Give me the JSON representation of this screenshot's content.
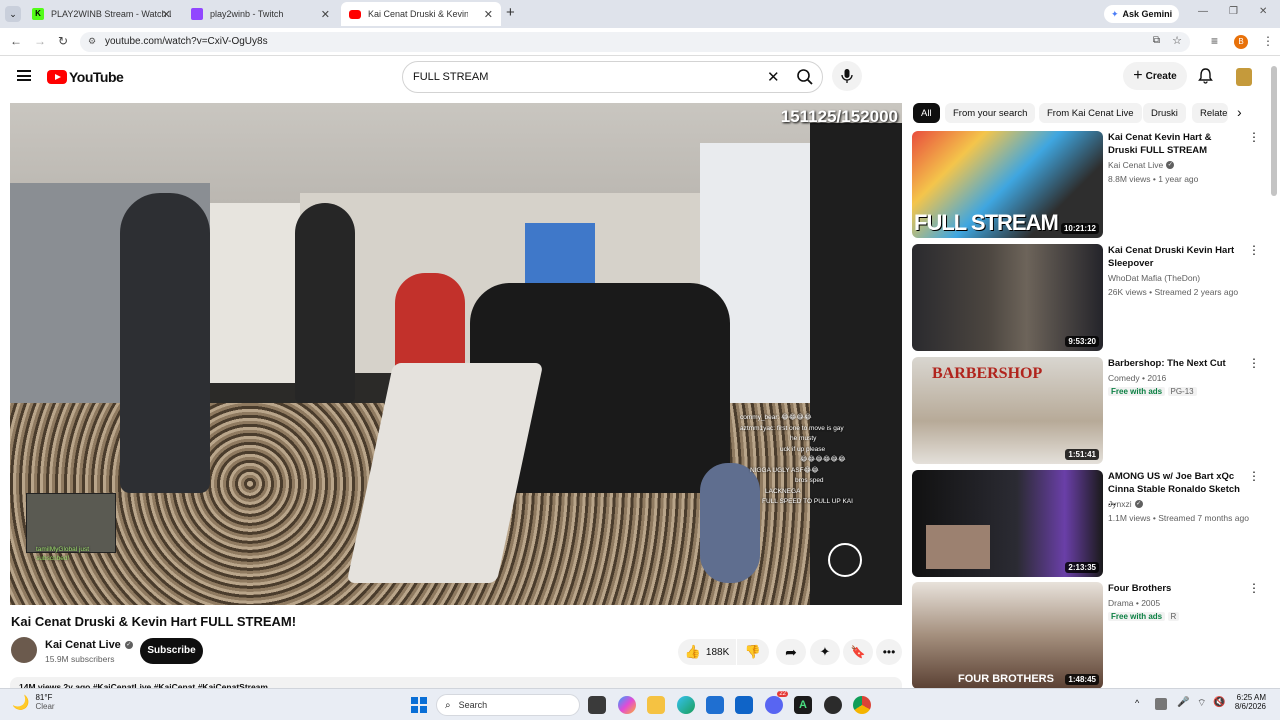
{
  "browser": {
    "tabs": [
      {
        "label": "PLAY2WINB Stream - Watch Liv",
        "active": false,
        "icon": "kick-icon"
      },
      {
        "label": "play2winb - Twitch",
        "active": false,
        "icon": "twitch-icon"
      },
      {
        "label": "Kai Cenat Druski & Kevin H",
        "active": true,
        "icon": "youtube-icon"
      }
    ],
    "new_tab": "+",
    "ask_gemini": "Ask Gemini",
    "url": "youtube.com/watch?v=CxiV-OgUy8s",
    "profile_initial": "B"
  },
  "youtube": {
    "logo_text": "YouTube",
    "search_value": "FULL STREAM",
    "create_label": "Create"
  },
  "video": {
    "overlay_counter": "151125/152000",
    "title": "Kai Cenat Druski & Kevin Hart FULL STREAM!",
    "channel": "Kai Cenat Live",
    "subscribers": "15.9M subscribers",
    "subscribe_label": "Subscribe",
    "likes": "188K",
    "description_line": "14M views  2y ago  #KaiCenatLive #KaiCenat #KaiCenatStream",
    "chat_lines": [
      "commy_bear: 😂😂😂😂",
      "aztmm1yac: first one to move is gay",
      "he musty",
      "uck if up please",
      "😂😂😂😂😂😂",
      "NIGGA UGLY ASF😂😂",
      "bros sped",
      "LACKNEGA",
      "FULL SPEED TO PULL UP KAI"
    ],
    "sub_alert": "tamilMyGlobal just subscribed!"
  },
  "sidebar": {
    "chips": [
      "All",
      "From your search",
      "From Kai Cenat Live",
      "Druski",
      "Relate"
    ],
    "recommendations": [
      {
        "title": "Kai Cenat Kevin Hart & Druski FULL STREAM",
        "channel": "Kai Cenat Live",
        "verified": true,
        "meta": "8.8M views • 1 year ago",
        "duration": "10:21:12",
        "thumb_text": "FULL STREAM"
      },
      {
        "title": "Kai Cenat Druski Kevin Hart Sleepover",
        "channel": "WhoDat Mafia (TheDon)",
        "verified": false,
        "meta": "26K views • Streamed 2 years ago",
        "duration": "9:53:20",
        "thumb_text": ""
      },
      {
        "title": "Barbershop: The Next Cut",
        "channel": "Comedy • 2016",
        "verified": false,
        "meta_tag": "Free with ads",
        "rating": "PG-13",
        "duration": "1:51:41",
        "thumb_text": "BARBERSHOP"
      },
      {
        "title": "AMONG US w/ Joe Bart xQc Cinna Stable Ronaldo Sketch ...",
        "channel": "Jynxzi",
        "verified": true,
        "meta": "1.1M views • Streamed 7 months ago",
        "duration": "2:13:35",
        "thumb_text": ""
      },
      {
        "title": "Four Brothers",
        "channel": "Drama • 2005",
        "verified": false,
        "meta_tag": "Free with ads",
        "rating": "R",
        "duration": "1:48:45",
        "thumb_text": "FOUR BROTHERS"
      }
    ]
  },
  "taskbar": {
    "weather_temp": "81°F",
    "weather_desc": "Clear",
    "search_label": "Search",
    "time": "6:25 AM",
    "date": "8/6/2026",
    "discord_badge": "22"
  },
  "colors": {
    "youtube_red": "#ff0000",
    "accent_blue": "#065fd4"
  }
}
